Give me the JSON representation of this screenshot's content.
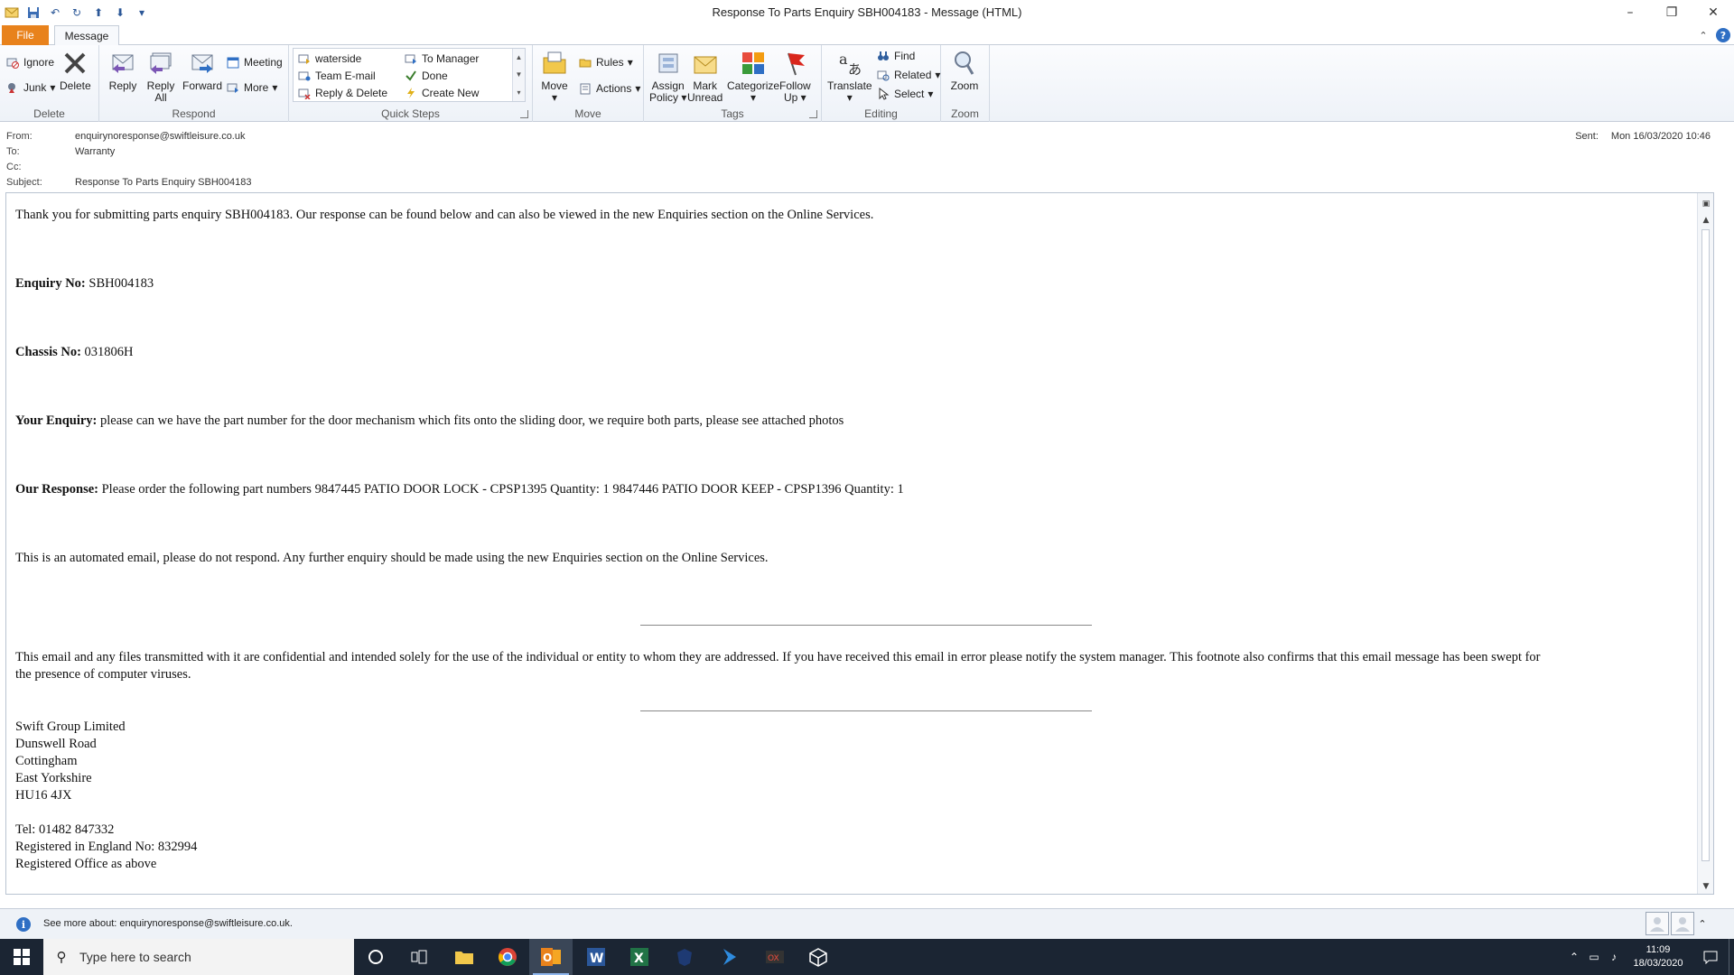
{
  "window": {
    "title": "Response To Parts Enquiry SBH004183  -  Message (HTML)"
  },
  "tabs": {
    "file": "File",
    "message": "Message"
  },
  "ribbon": {
    "delete_group": {
      "label": "Delete",
      "ignore": "Ignore",
      "junk": "Junk",
      "delete": "Delete"
    },
    "respond_group": {
      "label": "Respond",
      "reply": "Reply",
      "reply_all_1": "Reply",
      "reply_all_2": "All",
      "forward": "Forward",
      "meeting": "Meeting",
      "more": "More"
    },
    "quicksteps_group": {
      "label": "Quick Steps",
      "items": [
        "waterside",
        "Team E-mail",
        "Reply & Delete",
        "To Manager",
        "Done",
        "Create New"
      ]
    },
    "move_group": {
      "label": "Move",
      "move": "Move",
      "rules": "Rules",
      "actions": "Actions"
    },
    "tags_group": {
      "label": "Tags",
      "assign_policy_1": "Assign",
      "assign_policy_2": "Policy",
      "mark_unread_1": "Mark",
      "mark_unread_2": "Unread",
      "categorize": "Categorize",
      "follow_up_1": "Follow",
      "follow_up_2": "Up"
    },
    "editing_group": {
      "label": "Editing",
      "translate": "Translate",
      "find": "Find",
      "related": "Related",
      "select": "Select"
    },
    "zoom_group": {
      "label": "Zoom",
      "zoom": "Zoom"
    }
  },
  "header": {
    "from_label": "From:",
    "from_value": "enquirynoresponse@swiftleisure.co.uk",
    "to_label": "To:",
    "to_value": "Warranty",
    "cc_label": "Cc:",
    "subject_label": "Subject:",
    "subject_value": "Response To Parts Enquiry SBH004183",
    "sent_label": "Sent:",
    "sent_value": "Mon 16/03/2020 10:46"
  },
  "body": {
    "intro": "Thank you for submitting parts enquiry SBH004183. Our response can be found below and can also be viewed in the new Enquiries section on the Online Services.",
    "enquiry_no_label": "Enquiry No:",
    "enquiry_no_value": " SBH004183",
    "chassis_no_label": "Chassis No:",
    "chassis_no_value": " 031806H",
    "your_enquiry_label": "Your Enquiry:",
    "your_enquiry_value": " please can we have the part number for the door mechanism which fits onto the sliding door, we require both parts, please see attached photos",
    "our_response_label": "Our Response:",
    "our_response_value": " Please order the following part numbers 9847445 PATIO DOOR LOCK - CPSP1395 Quantity: 1 9847446 PATIO DOOR KEEP - CPSP1396 Quantity: 1",
    "automated_note": "This is an automated email, please do not respond. Any further enquiry should be made using the new Enquiries section on the Online Services.",
    "disclaimer_line1": "This email and any files transmitted with it are confidential and intended solely for the use of the individual or entity to whom they are addressed. If you have received this email in error please notify the system manager. This footnote also confirms that this email message has been swept for",
    "disclaimer_line2": "the presence of computer viruses.",
    "address": [
      "Swift Group Limited",
      "Dunswell Road",
      "Cottingham",
      "East Yorkshire",
      "HU16 4JX"
    ],
    "tel": "Tel: 01482 847332",
    "registered": "Registered in England No: 832994",
    "registered_office": "Registered Office as above"
  },
  "people_pane": {
    "see_more": "See more about: enquirynoresponse@swiftleisure.co.uk."
  },
  "taskbar": {
    "search_placeholder": "Type here to search",
    "time": "11:09",
    "date": "18/03/2020"
  },
  "colors": {
    "file_tab": "#e8821c",
    "taskbar": "#1b2533",
    "accent": "#2f6fc4"
  }
}
